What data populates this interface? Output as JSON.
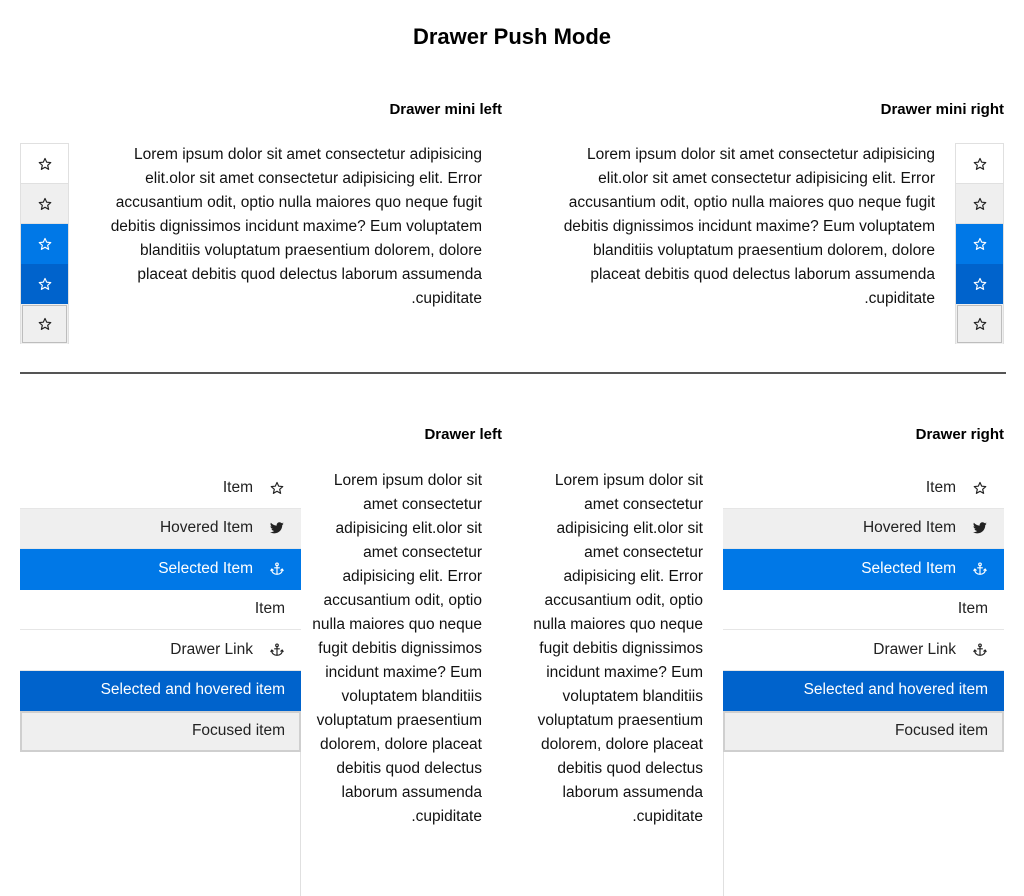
{
  "page_title": "Drawer Push Mode",
  "sections": {
    "mini_left_title": "Drawer mini left",
    "mini_right_title": "Drawer mini right",
    "left_title": "Drawer left",
    "right_title": "Drawer right"
  },
  "lorem": "Lorem ipsum dolor sit amet consectetur adipisicing elit.olor sit amet consectetur adipisicing elit. Error accusantium odit, optio nulla maiores quo neque fugit debitis dignissimos incidunt maxime? Eum voluptatem blanditiis voluptatum praesentium dolorem, dolore placeat debitis quod delectus laborum assumenda .cupiditate",
  "mini_items": [
    {
      "icon": "star-outline-icon",
      "state": "normal"
    },
    {
      "icon": "star-outline-icon",
      "state": "hovered"
    },
    {
      "icon": "star-outline-icon",
      "state": "selected"
    },
    {
      "icon": "star-outline-icon",
      "state": "selected-hovered"
    },
    {
      "icon": "star-outline-icon",
      "state": "focused"
    }
  ],
  "drawer_items": [
    {
      "label": "Item",
      "icon": "star-outline-icon",
      "state": "normal"
    },
    {
      "label": "Hovered Item",
      "icon": "twitter-icon",
      "state": "hovered"
    },
    {
      "label": "Selected Item",
      "icon": "anchor-icon",
      "state": "selected"
    },
    {
      "label": "Item",
      "icon": "",
      "state": "normal"
    },
    {
      "label": "Drawer Link",
      "icon": "anchor-icon",
      "state": "normal"
    },
    {
      "label": "Selected and hovered item",
      "icon": "",
      "state": "selected-hovered"
    },
    {
      "label": "Focused item",
      "icon": "",
      "state": "focused"
    }
  ],
  "colors": {
    "selected": "#0078e7",
    "selected_hovered": "#0063cc",
    "hovered": "#efefef"
  }
}
